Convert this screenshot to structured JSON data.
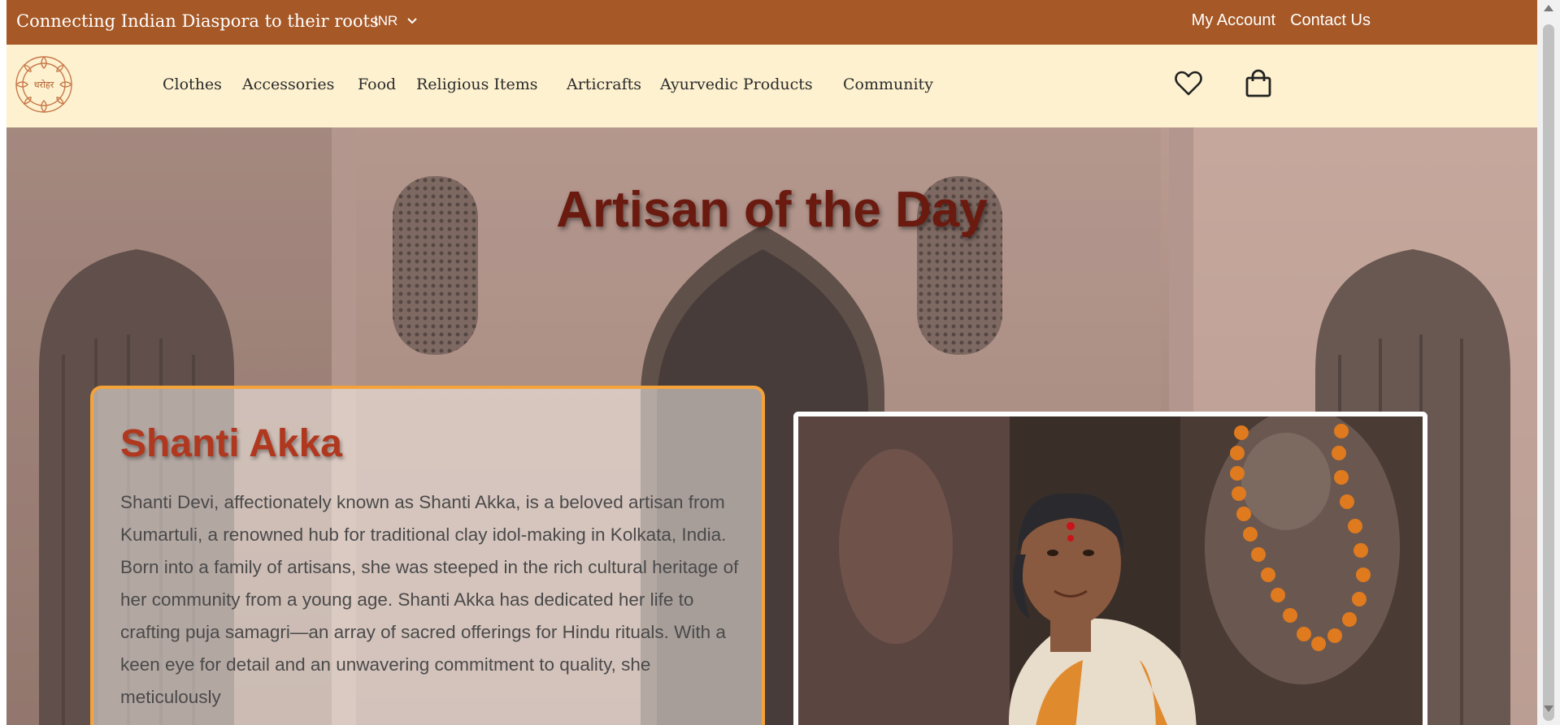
{
  "topbar": {
    "tagline": "Connecting Indian Diaspora to their roots",
    "currency": "INR",
    "links": [
      "My Account",
      "Contact Us"
    ]
  },
  "navbar": {
    "logo_text": "धरोहर",
    "menu": [
      "Clothes",
      "Accessories",
      "Food",
      "Religious Items",
      "Articrafts",
      "Ayurvedic Products",
      "Community"
    ],
    "icons": [
      "heart-icon",
      "shopping-bag-icon"
    ]
  },
  "hero": {
    "title": "Artisan of the Day",
    "artisan_name": "Shanti Akka",
    "artisan_bio": "Shanti Devi, affectionately known as Shanti Akka, is a beloved artisan from Kumartuli, a renowned hub for traditional clay idol-making in Kolkata, India. Born into a family of artisans, she was steeped in the rich cultural heritage of her community from a young age. Shanti Akka has dedicated her life to crafting puja samagri—an array of sacred offerings for Hindu rituals. With a keen eye for detail and an unwavering commitment to quality, she meticulously"
  },
  "colors": {
    "topbar": "#a65826",
    "navbar": "#fdf1cf",
    "title": "#6b1a0f",
    "card_border": "#f4a33a",
    "name": "#b0381f"
  }
}
